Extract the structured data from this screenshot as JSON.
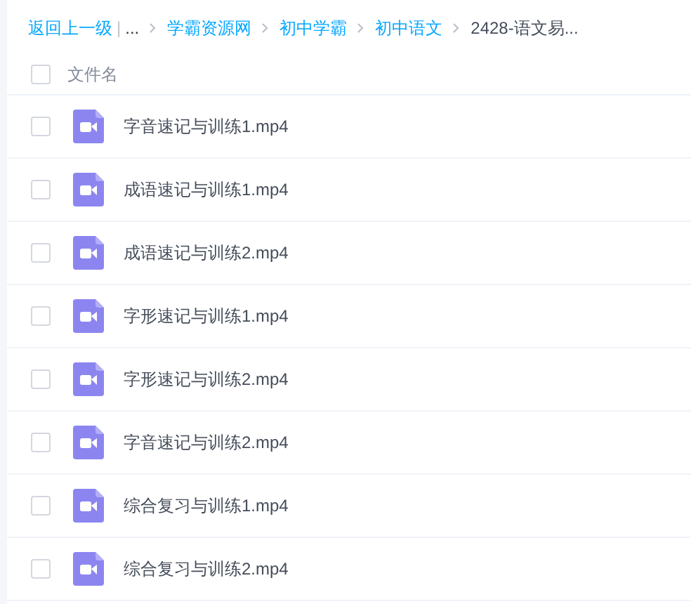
{
  "breadcrumb": {
    "back": "返回上一级",
    "separator": "|",
    "ellipsis": "...",
    "items": [
      {
        "label": "学霸资源网",
        "kind": "link"
      },
      {
        "label": "初中学霸",
        "kind": "link"
      },
      {
        "label": "初中语文",
        "kind": "link"
      },
      {
        "label": "2428-语文易...",
        "kind": "current"
      }
    ]
  },
  "header": {
    "checked": false,
    "label": "文件名"
  },
  "files": [
    {
      "name": "字音速记与训练1.mp4",
      "checked": false
    },
    {
      "name": "成语速记与训练1.mp4",
      "checked": false
    },
    {
      "name": "成语速记与训练2.mp4",
      "checked": false
    },
    {
      "name": "字形速记与训练1.mp4",
      "checked": false
    },
    {
      "name": "字形速记与训练2.mp4",
      "checked": false
    },
    {
      "name": "字音速记与训练2.mp4",
      "checked": false
    },
    {
      "name": "综合复习与训练1.mp4",
      "checked": false
    },
    {
      "name": "综合复习与训练2.mp4",
      "checked": false
    }
  ]
}
